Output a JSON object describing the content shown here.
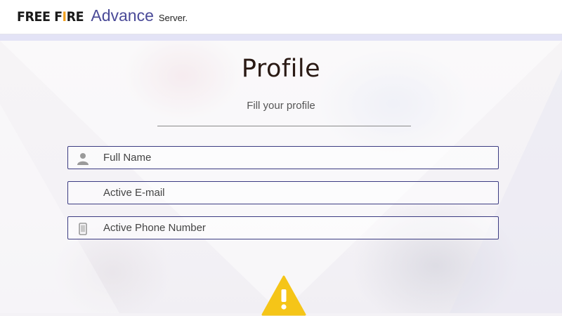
{
  "header": {
    "logo_brand_pre": "FREE F",
    "logo_brand_i": "I",
    "logo_brand_post": "RE",
    "logo_advance": "Advance",
    "logo_server": "Server."
  },
  "main": {
    "title": "Profile",
    "subtitle": "Fill your profile"
  },
  "form": {
    "fields": [
      {
        "placeholder": "Full Name",
        "value": "",
        "icon": "user-icon"
      },
      {
        "placeholder": "Active E-mail",
        "value": "",
        "icon": ""
      },
      {
        "placeholder": "Active Phone Number",
        "value": "",
        "icon": "phone-icon"
      }
    ]
  },
  "colors": {
    "accent": "#3c3c82",
    "brand_blue": "#4a4a98",
    "warning": "#f5c518"
  }
}
